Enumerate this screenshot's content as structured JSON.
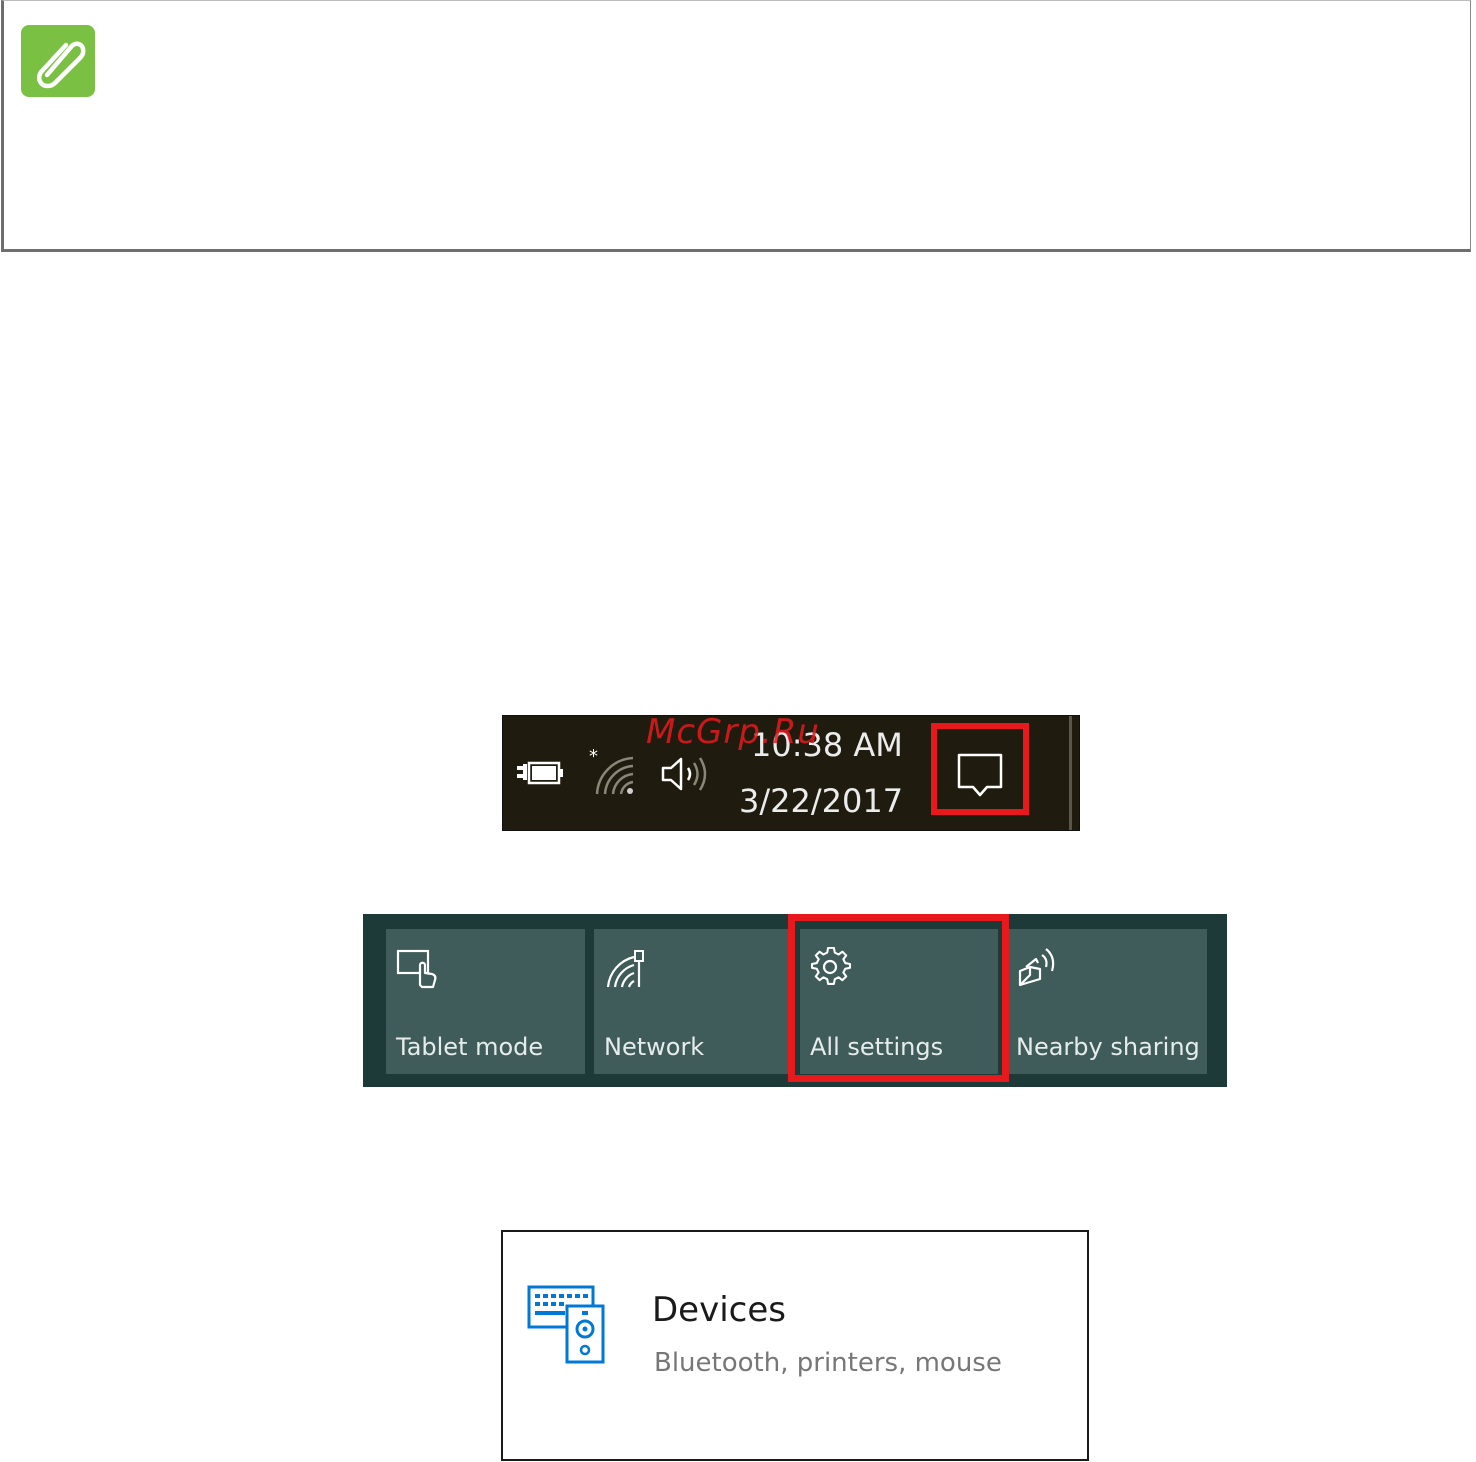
{
  "watermark": "McGrp.Ru",
  "taskbar": {
    "time": "10:38 AM",
    "date": "3/22/2017",
    "icons": [
      "battery-charging-icon",
      "wifi-icon",
      "volume-icon",
      "action-center-icon"
    ],
    "highlight_color": "#e8191d"
  },
  "quick_actions": {
    "tiles": [
      {
        "label": "Tablet mode",
        "icon": "tablet-mode-icon"
      },
      {
        "label": "Network",
        "icon": "network-icon"
      },
      {
        "label": "All settings",
        "icon": "gear-icon"
      },
      {
        "label": "Nearby sharing",
        "icon": "nearby-sharing-icon"
      }
    ],
    "highlighted": "All settings"
  },
  "settings_card": {
    "title": "Devices",
    "subtitle": "Bluetooth, printers, mouse",
    "icon": "devices-icon",
    "icon_color": "#0078d7"
  },
  "note": {
    "icon": "paperclip-icon",
    "icon_color": "#7ac143"
  }
}
